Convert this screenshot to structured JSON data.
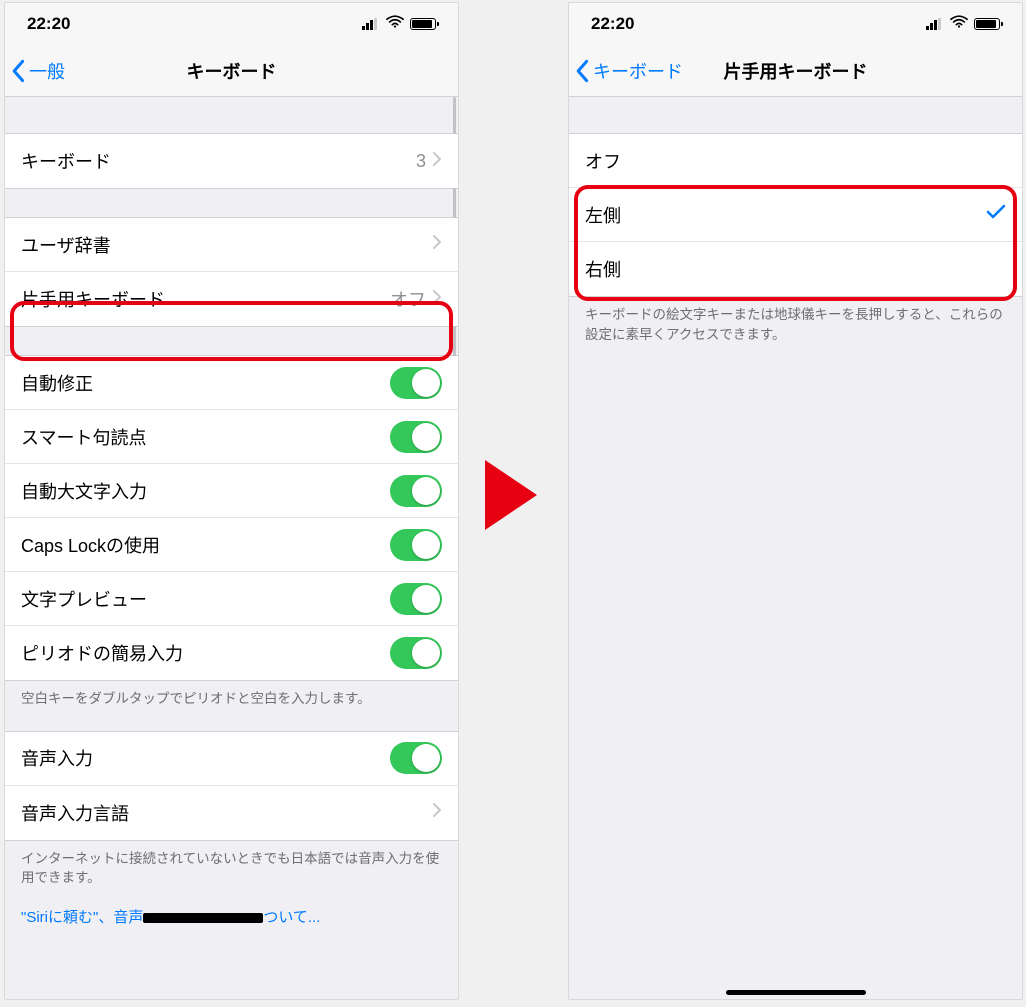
{
  "status": {
    "time": "22:20"
  },
  "arrow_color": "#e60012",
  "left": {
    "back_label": "一般",
    "title": "キーボード",
    "rows": {
      "keyboards": {
        "label": "キーボード",
        "detail": "3"
      },
      "user_dict": {
        "label": "ユーザ辞書"
      },
      "one_handed": {
        "label": "片手用キーボード",
        "detail": "オフ"
      },
      "auto_correct": {
        "label": "自動修正"
      },
      "smart_punct": {
        "label": "スマート句読点"
      },
      "auto_caps": {
        "label": "自動大文字入力"
      },
      "caps_lock": {
        "label": "Caps Lockの使用"
      },
      "char_preview": {
        "label": "文字プレビュー"
      },
      "period_shortcut": {
        "label": "ピリオドの簡易入力"
      },
      "dictation": {
        "label": "音声入力"
      },
      "dictation_lang": {
        "label": "音声入力言語"
      }
    },
    "footers": {
      "period": "空白キーをダブルタップでピリオドと空白を入力します。",
      "dictation": "インターネットに接続されていないときでも日本語では音声入力を使用できます。"
    },
    "link_prefix": "\"Siriに頼む\"、音声",
    "link_suffix": "ついて..."
  },
  "right": {
    "back_label": "キーボード",
    "title": "片手用キーボード",
    "options": {
      "off": {
        "label": "オフ",
        "selected": false
      },
      "left": {
        "label": "左側",
        "selected": true
      },
      "right": {
        "label": "右側",
        "selected": false
      }
    },
    "footer": "キーボードの絵文字キーまたは地球儀キーを長押しすると、これらの設定に素早くアクセスできます。"
  }
}
